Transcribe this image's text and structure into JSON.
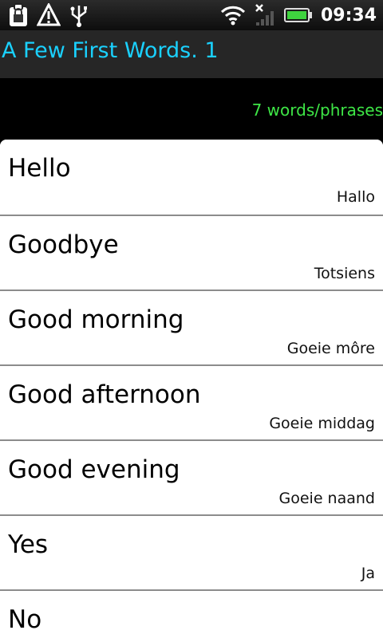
{
  "status_bar": {
    "time": "09:34",
    "icons": [
      "clipboard-icon",
      "warning-icon",
      "usb-icon",
      "wifi-icon",
      "no-signal-icon",
      "battery-icon"
    ]
  },
  "app": {
    "title": "A Few First Words. 1",
    "count_label": "7 words/phrases"
  },
  "list": {
    "items": [
      {
        "english": "Hello",
        "afrikaans": "Hallo"
      },
      {
        "english": "Goodbye",
        "afrikaans": "Totsiens"
      },
      {
        "english": "Good morning",
        "afrikaans": "Goeie môre"
      },
      {
        "english": "Good afternoon",
        "afrikaans": "Goeie middag"
      },
      {
        "english": "Good evening",
        "afrikaans": "Goeie naand"
      },
      {
        "english": "Yes",
        "afrikaans": "Ja"
      },
      {
        "english": "No",
        "afrikaans": ""
      }
    ]
  },
  "colors": {
    "title": "#1ad1ff",
    "count": "#3ee646",
    "list_bg": "#ffffff"
  }
}
